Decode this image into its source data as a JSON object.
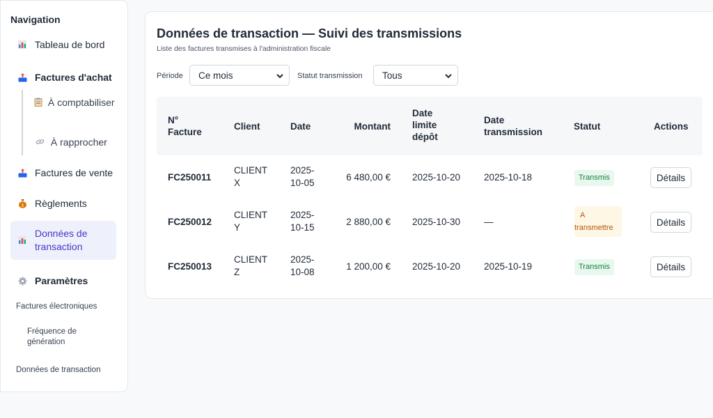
{
  "sidebar": {
    "title": "Navigation",
    "dashboard": "Tableau de bord",
    "purchases": "Factures d'achat",
    "to_book": "À comptabiliser",
    "to_match": "À rapprocher",
    "sales": "Factures de vente",
    "payments": "Règlements",
    "transactions": "Données de transaction",
    "settings": "Paramètres",
    "e_invoices": "Factures électroniques",
    "frequency": "Fréquence de génération",
    "tx_data": "Données de transaction"
  },
  "main": {
    "title": "Données de transaction — Suivi des transmissions",
    "subtitle": "Liste des factures transmises à l'administration fiscale",
    "period_label": "Période",
    "period_value": "Ce mois",
    "status_label": "Statut transmission",
    "status_value": "Tous"
  },
  "table": {
    "headers": {
      "invoice": "N° Facture",
      "client": "Client",
      "date": "Date",
      "amount": "Montant",
      "deadline": "Date limite dépôt",
      "transmission": "Date transmission",
      "status": "Statut",
      "actions": "Actions"
    },
    "rows": [
      {
        "invoice": "FC250011",
        "client": "CLIENT X",
        "date": "2025-10-05",
        "amount": "6 480,00 €",
        "deadline": "2025-10-20",
        "transmission": "2025-10-18",
        "status": "Transmis",
        "action": "Détails"
      },
      {
        "invoice": "FC250012",
        "client": "CLIENT Y",
        "date": "2025-10-15",
        "amount": "2 880,00 €",
        "deadline": "2025-10-30",
        "transmission": "—",
        "status": "A transmettre",
        "action": "Détails"
      },
      {
        "invoice": "FC250013",
        "client": "CLIENT Z",
        "date": "2025-10-08",
        "amount": "1 200,00 €",
        "deadline": "2025-10-20",
        "transmission": "2025-10-19",
        "status": "Transmis",
        "action": "Détails"
      }
    ]
  },
  "colors": {
    "accent": "#4338ca",
    "success": "#15803d",
    "warning": "#b45309"
  }
}
